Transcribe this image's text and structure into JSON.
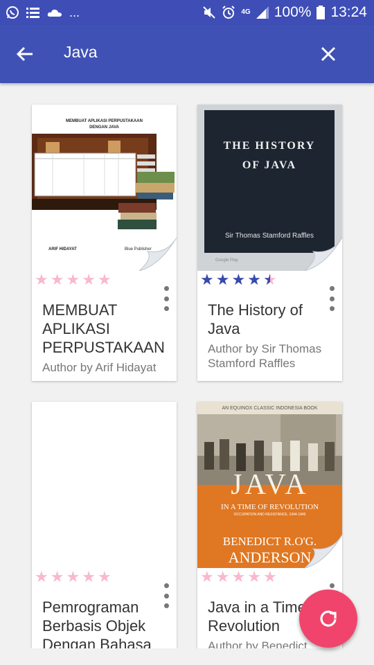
{
  "status_bar": {
    "left_icons": [
      "whatsapp-icon",
      "list-icon",
      "cloud-icon"
    ],
    "more": "...",
    "network": "4G",
    "battery_percent": "100%",
    "time": "13:24"
  },
  "appbar": {
    "search_query": "Java",
    "back_icon": "arrow-left-icon",
    "close_icon": "close-icon"
  },
  "books": [
    {
      "title": "MEMBUAT APLIKASI PERPUSTAKAAN",
      "author": "Author by Arif Hidayat",
      "rating": 0,
      "cover": {
        "heading_line1": "MEMBUAT APLIKASI PERPUSTAKAAN",
        "heading_line2": "DENGAN JAVA",
        "author": "ARIF HIDAYAT",
        "publisher": "Blue Publisher"
      }
    },
    {
      "title": "The History of Java",
      "author": "Author by Sir Thomas Stamford Raffles",
      "rating": 4.5,
      "cover": {
        "heading_line1": "THE HISTORY",
        "heading_line2": "OF JAVA",
        "author": "Sir Thomas Stamford Raffles",
        "footer": "Google Play"
      }
    },
    {
      "title": "Pemrograman Berbasis Objek Dengan Bahasa",
      "author": "",
      "rating": 0,
      "cover": {}
    },
    {
      "title": "Java in a Time of Revolution",
      "author": "Author by Benedict",
      "rating": 0,
      "cover": {
        "series": "AN EQUINOX CLASSIC INDONESIA BOOK",
        "heading": "JAVA",
        "subtitle": "IN A TIME OF REVOLUTION",
        "subtitle2": "OCCUPATION AND RESISTANCE, 1944-1946",
        "author_line1": "BENEDICT R.O'G.",
        "author_line2": "ANDERSON"
      }
    }
  ],
  "fab": {
    "icon": "refresh-icon"
  },
  "colors": {
    "appbar": "#3f51b5",
    "status_bar": "#3e4eb6",
    "star_filled": "#3949ab",
    "star_empty": "#f8b8d0",
    "fab": "#f0446c"
  }
}
